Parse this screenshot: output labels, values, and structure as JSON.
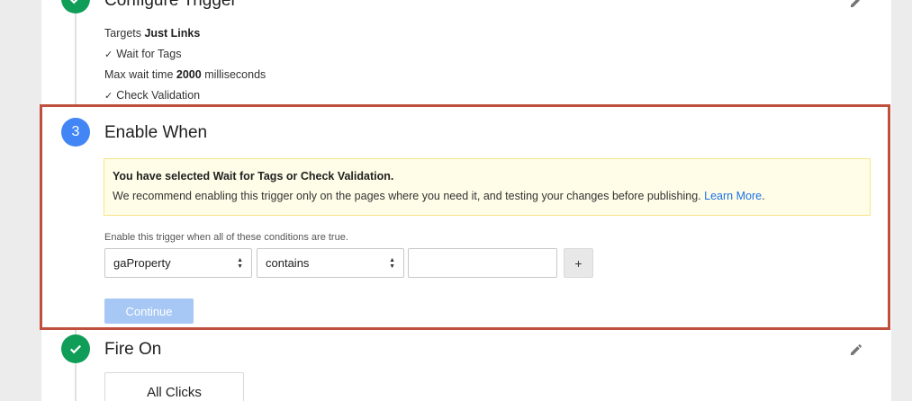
{
  "configure_trigger": {
    "title": "Configure Trigger",
    "targets_prefix": "Targets",
    "targets_value": "Just Links",
    "wait_for_tags": "Wait for Tags",
    "max_wait_prefix": "Max wait time",
    "max_wait_value": "2000",
    "max_wait_suffix": "milliseconds",
    "check_validation": "Check Validation"
  },
  "enable_when": {
    "step_number": "3",
    "title": "Enable When",
    "notice_title": "You have selected Wait for Tags or Check Validation.",
    "notice_body": "We recommend enabling this trigger only on the pages where you need it, and testing your changes before publishing.",
    "notice_link": "Learn More",
    "notice_link_suffix": ".",
    "conditions_label": "Enable this trigger when all of these conditions are true.",
    "variable_select": "gaProperty",
    "operator_select": "contains",
    "value_input": "",
    "add_label": "+",
    "continue_label": "Continue"
  },
  "fire_on": {
    "title": "Fire On",
    "all_clicks_label": "All Clicks"
  },
  "colors": {
    "done": "#0f9d58",
    "active": "#4285f4",
    "highlight_border": "#c0503e",
    "link": "#1a73e8"
  },
  "icons": {
    "step_done": "check-icon",
    "edit": "pencil-icon",
    "select_arrows": "updown-arrows-icon"
  }
}
